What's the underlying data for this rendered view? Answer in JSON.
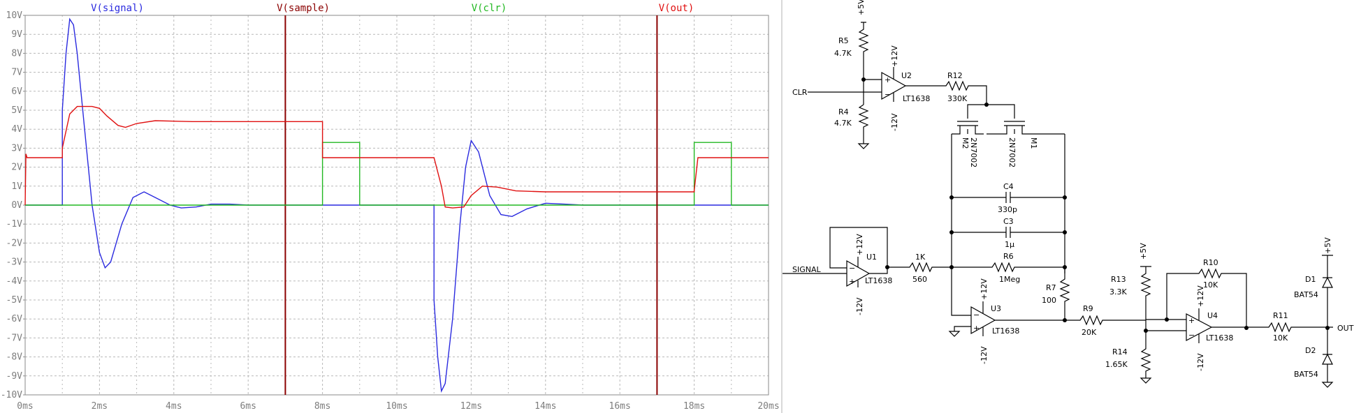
{
  "chart_data": {
    "type": "line",
    "title": "",
    "xlabel": "",
    "ylabel": "",
    "xlim": [
      0,
      20
    ],
    "ylim": [
      -10,
      10
    ],
    "grid": true,
    "x_tick_labels": [
      "0ms",
      "2ms",
      "4ms",
      "6ms",
      "8ms",
      "10ms",
      "12ms",
      "14ms",
      "16ms",
      "18ms",
      "20ms"
    ],
    "y_tick_labels": [
      "10V",
      "9V",
      "8V",
      "7V",
      "6V",
      "5V",
      "4V",
      "3V",
      "2V",
      "1V",
      "0V",
      "-1V",
      "-2V",
      "-3V",
      "-4V",
      "-5V",
      "-6V",
      "-7V",
      "-8V",
      "-9V",
      "-10V"
    ],
    "series": [
      {
        "name": "V(signal)",
        "color": "#2a2adf",
        "points": [
          [
            0.0,
            0
          ],
          [
            1.0,
            0
          ],
          [
            1.0,
            5.0
          ],
          [
            1.1,
            8.0
          ],
          [
            1.2,
            9.8
          ],
          [
            1.3,
            9.5
          ],
          [
            1.4,
            8.0
          ],
          [
            1.6,
            4.0
          ],
          [
            1.8,
            0.0
          ],
          [
            2.0,
            -2.5
          ],
          [
            2.15,
            -3.3
          ],
          [
            2.3,
            -3.0
          ],
          [
            2.6,
            -1.0
          ],
          [
            2.9,
            0.4
          ],
          [
            3.2,
            0.7
          ],
          [
            3.5,
            0.4
          ],
          [
            3.9,
            0.0
          ],
          [
            4.2,
            -0.15
          ],
          [
            4.6,
            -0.1
          ],
          [
            5.0,
            0.05
          ],
          [
            5.5,
            0.05
          ],
          [
            6.0,
            0
          ],
          [
            8.0,
            0
          ],
          [
            11.0,
            0
          ],
          [
            11.0,
            -5.0
          ],
          [
            11.1,
            -8.0
          ],
          [
            11.2,
            -9.8
          ],
          [
            11.3,
            -9.4
          ],
          [
            11.5,
            -6.0
          ],
          [
            11.7,
            -1.0
          ],
          [
            11.85,
            2.0
          ],
          [
            12.0,
            3.4
          ],
          [
            12.2,
            2.8
          ],
          [
            12.5,
            0.5
          ],
          [
            12.8,
            -0.5
          ],
          [
            13.1,
            -0.6
          ],
          [
            13.5,
            -0.2
          ],
          [
            14.0,
            0.1
          ],
          [
            14.5,
            0.05
          ],
          [
            15.0,
            0
          ],
          [
            20.0,
            0
          ]
        ]
      },
      {
        "name": "V(sample)",
        "color": "#8b0000",
        "vertical_marker_at_ms": 7
      },
      {
        "name": "V(clr)",
        "color": "#22b822",
        "points": [
          [
            0,
            0
          ],
          [
            8.0,
            0
          ],
          [
            8.0,
            3.3
          ],
          [
            9.0,
            3.3
          ],
          [
            9.0,
            0
          ],
          [
            18.0,
            0
          ],
          [
            18.0,
            3.3
          ],
          [
            19.0,
            3.3
          ],
          [
            19.0,
            0
          ],
          [
            20.0,
            0
          ]
        ]
      },
      {
        "name": "V(out)",
        "color": "#e01010",
        "vertical_marker_at_ms": 17,
        "points": [
          [
            0,
            0
          ],
          [
            0.02,
            2.7
          ],
          [
            0.05,
            2.5
          ],
          [
            1.0,
            2.5
          ],
          [
            1.0,
            3.0
          ],
          [
            1.2,
            4.8
          ],
          [
            1.4,
            5.2
          ],
          [
            1.8,
            5.2
          ],
          [
            2.0,
            5.1
          ],
          [
            2.2,
            4.7
          ],
          [
            2.5,
            4.2
          ],
          [
            2.7,
            4.1
          ],
          [
            3.0,
            4.3
          ],
          [
            3.5,
            4.45
          ],
          [
            4.5,
            4.4
          ],
          [
            6.0,
            4.4
          ],
          [
            8.0,
            4.4
          ],
          [
            8.0,
            2.5
          ],
          [
            11.0,
            2.5
          ],
          [
            11.2,
            1.0
          ],
          [
            11.3,
            -0.1
          ],
          [
            11.5,
            -0.15
          ],
          [
            11.8,
            -0.1
          ],
          [
            12.0,
            0.5
          ],
          [
            12.3,
            1.0
          ],
          [
            12.7,
            0.95
          ],
          [
            13.2,
            0.75
          ],
          [
            14.0,
            0.7
          ],
          [
            16.0,
            0.7
          ],
          [
            18.0,
            0.7
          ],
          [
            18.0,
            0.75
          ],
          [
            18.1,
            2.5
          ],
          [
            20.0,
            2.5
          ]
        ]
      }
    ]
  },
  "schematic": {
    "labels": {
      "vcc5_a": "+5V",
      "r5": "R5",
      "r5_val": "4.7K",
      "clr_net": "CLR",
      "u2": "U2",
      "u2_part": "LT1638",
      "u2_pos": "+12V",
      "u2_neg": "-12V",
      "r12": "R12",
      "r12_val": "330K",
      "r4": "R4",
      "r4_val": "4.7K",
      "m2": "M2",
      "m2_part": "2N7002",
      "m1": "M1",
      "m1_part": "2N7002",
      "c4": "C4",
      "c4_val": "330p",
      "c3": "C3",
      "c3_val": "1µ",
      "r6": "R6",
      "r6_val": "1Meg",
      "signal_net": "SIGNAL",
      "u1": "U1",
      "u1_part": "LT1638",
      "u1_pos": "+12V",
      "u1_neg": "-12V",
      "r_in": "1K",
      "r_in_val": "560",
      "r7": "R7",
      "r7_val": "100",
      "u3": "U3",
      "u3_part": "LT1638",
      "u3_pos": "+12V",
      "u3_neg": "-12V",
      "r9": "R9",
      "r9_val": "20K",
      "vcc5_b": "+5V",
      "r13": "R13",
      "r13_val": "3.3K",
      "r14": "R14",
      "r14_val": "1.65K",
      "r10": "R10",
      "r10_val": "10K",
      "u4": "U4",
      "u4_part": "LT1638",
      "u4_pos": "+12V",
      "u4_neg": "-12V",
      "r11": "R11",
      "r11_val": "10K",
      "vcc5_c": "+5V",
      "d1": "D1",
      "d1_part": "BAT54",
      "d2": "D2",
      "d2_part": "BAT54",
      "out_net": "OUT"
    }
  }
}
